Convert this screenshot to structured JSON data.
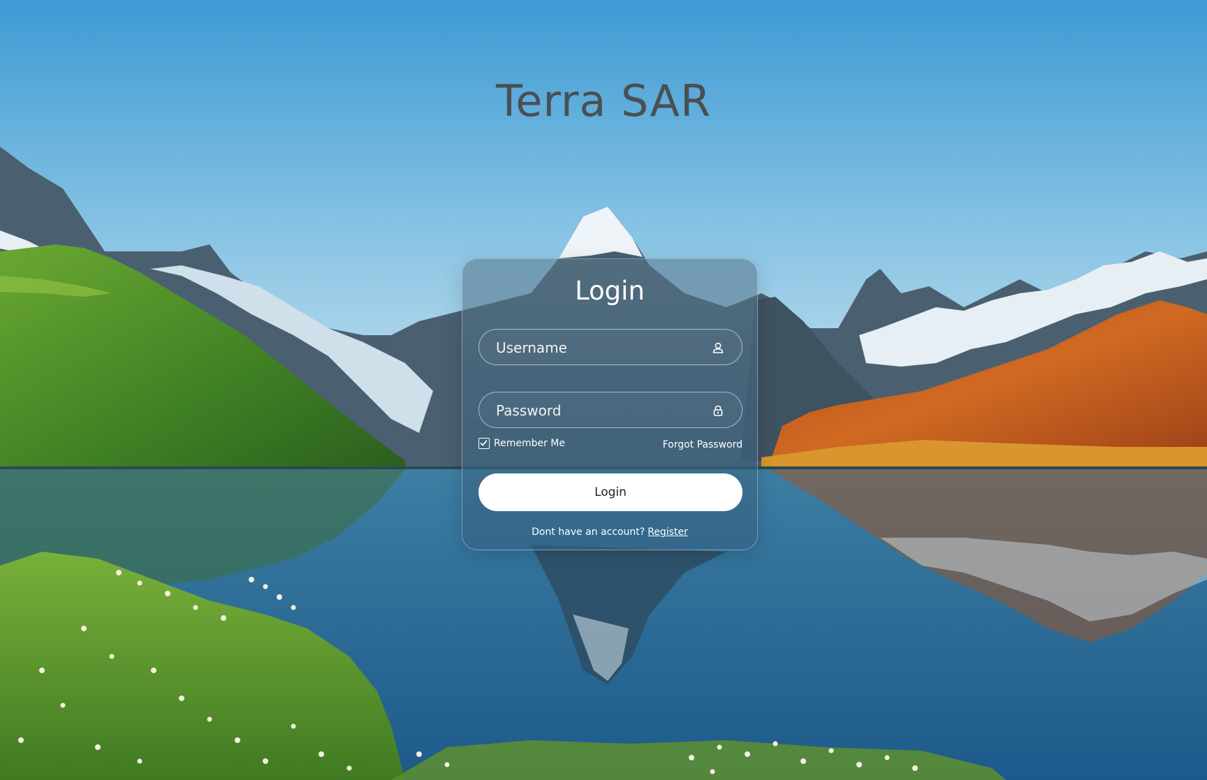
{
  "app": {
    "title": "Terra SAR"
  },
  "login_form": {
    "heading": "Login",
    "username": {
      "value": "",
      "placeholder": "Username",
      "icon": "user-icon"
    },
    "password": {
      "value": "",
      "placeholder": "Password",
      "icon": "lock-icon"
    },
    "remember_me": {
      "label": "Remember Me",
      "checked": true
    },
    "forgot_password_label": "Forgot Password",
    "submit_label": "Login",
    "register_prompt": "Dont have an account?",
    "register_link_label": "Register"
  },
  "colors": {
    "title_text": "#4a4f52",
    "card_text": "#ffffff",
    "button_background": "#ffffff",
    "button_text": "#222222"
  }
}
